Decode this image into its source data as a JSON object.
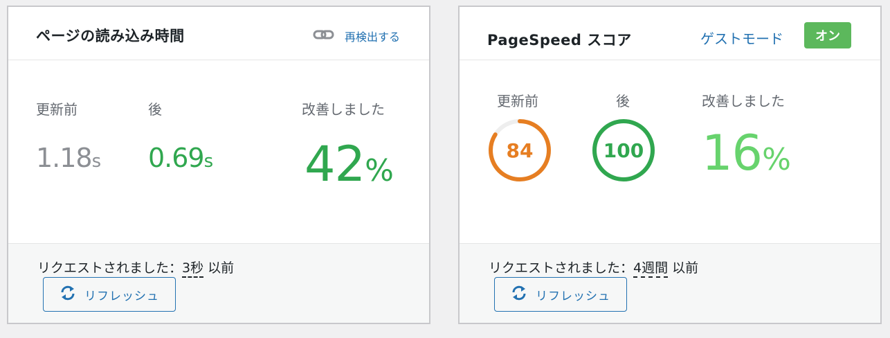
{
  "load_card": {
    "title": "ページの読み込み時間",
    "recheck_label": "再検出する",
    "labels": {
      "before": "更新前",
      "after": "後",
      "improved": "改善しました"
    },
    "before_value": "1.18",
    "before_unit": "s",
    "after_value": "0.69",
    "after_unit": "s",
    "improved_value": "42",
    "improved_unit": "%",
    "requested_prefix": "リクエストされました：",
    "requested_value": "3秒",
    "requested_suffix": "以前",
    "refresh_label": "リフレッシュ",
    "icons": {
      "recheck": "link-icon",
      "refresh": "refresh-icon"
    }
  },
  "pagespeed_card": {
    "title": "PageSpeed スコア",
    "guest_mode_label": "ゲストモード",
    "on_badge": "オン",
    "labels": {
      "before": "更新前",
      "after": "後",
      "improved": "改善しました"
    },
    "before_score": 84,
    "after_score": 100,
    "improved_value": "16",
    "improved_unit": "%",
    "requested_prefix": "リクエストされました：",
    "requested_value": "4週間",
    "requested_suffix": "以前",
    "refresh_label": "リフレッシュ",
    "icons": {
      "refresh": "refresh-icon"
    }
  },
  "colors": {
    "link": "#2271b1",
    "good": "#30a74f",
    "average": "#e67e22",
    "badge": "#5cb85c",
    "improved_light": "#67d36d"
  }
}
